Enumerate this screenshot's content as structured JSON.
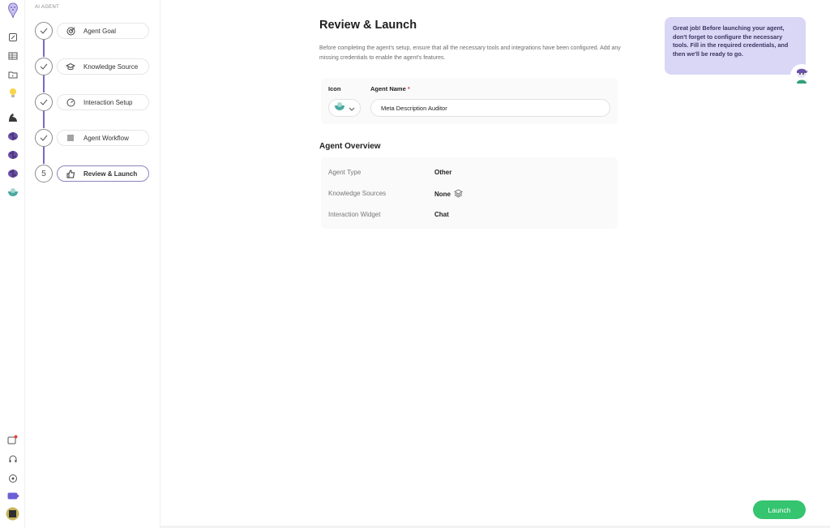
{
  "sidebar": {
    "section_label": "AI AGENT",
    "steps": [
      {
        "label": "Agent Goal",
        "state": "done",
        "icon": "target-icon"
      },
      {
        "label": "Knowledge Source",
        "state": "done",
        "icon": "graduation-cap-icon"
      },
      {
        "label": "Interaction Setup",
        "state": "done",
        "icon": "dial-icon"
      },
      {
        "label": "Agent Workflow",
        "state": "done",
        "icon": "list-icon"
      },
      {
        "label": "Review & Launch",
        "state": "active",
        "number": "5",
        "icon": "thumbs-up-icon"
      }
    ]
  },
  "main": {
    "title": "Review & Launch",
    "description": "Before completing the agent's setup, ensure that all the necessary tools and integrations have been configured. Add any missing credentials to enable the agent's features.",
    "icon_label": "Icon",
    "agent_name_label": "Agent Name",
    "required_mark": "*",
    "agent_name_value": "Meta Description Auditor",
    "overview_title": "Agent Overview",
    "overview": [
      {
        "key": "Agent Type",
        "value": "Other"
      },
      {
        "key": "Knowledge Sources",
        "value": "None"
      },
      {
        "key": "Interaction Widget",
        "value": "Chat"
      }
    ]
  },
  "tip": {
    "text": "Great job! Before launching your agent, don't forget to configure the necessary tools. Fill in the required credentials, and then we'll be ready to go."
  },
  "actions": {
    "launch_label": "Launch"
  },
  "colors": {
    "accent_purple": "#7a6ac8",
    "tip_background": "#d9d6f6",
    "launch_green": "#35c46f"
  }
}
